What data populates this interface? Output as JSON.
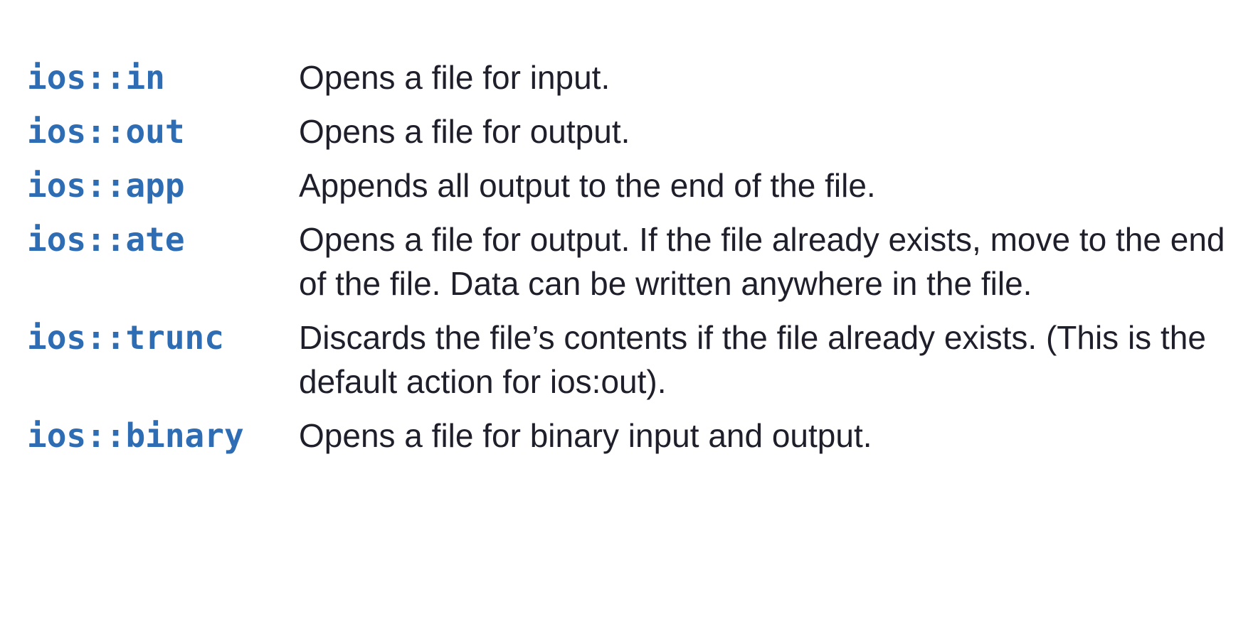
{
  "modes": [
    {
      "name": "ios::in",
      "description": "Opens a file for input."
    },
    {
      "name": "ios::out",
      "description": "Opens a file for output."
    },
    {
      "name": "ios::app",
      "description": "Appends all output to the end of the file."
    },
    {
      "name": "ios::ate",
      "description": "Opens a file for output. If the file already exists, move to the end of the file. Data can be written anywhere in the file."
    },
    {
      "name": "ios::trunc",
      "description": "Discards the file’s contents if the file already exists. (This is the default action for ios:out)."
    },
    {
      "name": "ios::binary",
      "description": "Opens a file for binary input and output."
    }
  ],
  "colors": {
    "mode_name": "#2e6db4",
    "description_text": "#1f1f2b",
    "background": "#ffffff"
  }
}
